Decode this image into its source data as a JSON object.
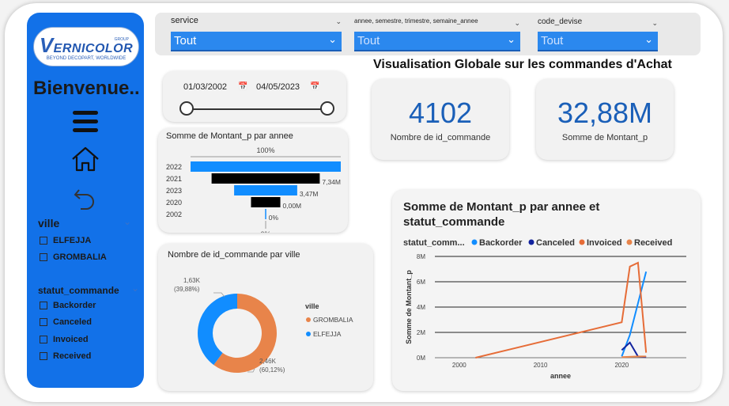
{
  "logo": {
    "brand": "ERNICOLOR",
    "brand_initial": "V",
    "tagline": "BEYOND DECOPART, WORLDWIDE",
    "group": "GROUP"
  },
  "sidebar": {
    "welcome": "Bienvenue..",
    "ville": {
      "title": "ville",
      "items": [
        "ELFEJJA",
        "GROMBALIA"
      ]
    },
    "statut": {
      "title": "statut_commande",
      "items": [
        "Backorder",
        "Canceled",
        "Invoiced",
        "Received"
      ]
    }
  },
  "filters": {
    "service": {
      "label": "service",
      "value": "Tout"
    },
    "periode": {
      "label": "annee, semestre, trimestre, semaine_annee",
      "value": "Tout"
    },
    "devise": {
      "label": "code_devise",
      "value": "Tout"
    }
  },
  "heading": "Visualisation Globale sur les commandes d'Achat",
  "date_range": {
    "start": "01/03/2002",
    "end": "04/05/2023"
  },
  "kpis": {
    "commandes": {
      "value": "4102",
      "label": "Nombre de id_commande"
    },
    "montant": {
      "value": "32,88M",
      "label": "Somme de Montant_p"
    }
  },
  "colors": {
    "accent": "#1271e8",
    "backorder": "#118dff",
    "canceled": "#12239e",
    "invoiced": "#e66c37",
    "received": "#e8844a"
  },
  "chart_data": [
    {
      "type": "bar",
      "title": "Somme de Montant_p par annee",
      "categories": [
        "2022",
        "2021",
        "2023",
        "2020",
        "2002"
      ],
      "values": [
        100,
        72,
        42,
        19.5,
        0
      ],
      "data_labels": [
        "100%",
        "",
        "7,34M",
        "3,47M",
        "0,00M",
        "0%"
      ],
      "top_label": "100%",
      "bottom_label": "0%",
      "bar_colors": [
        "#118dff",
        "#000000",
        "#118dff",
        "#000000",
        "#118dff"
      ]
    },
    {
      "type": "pie",
      "title": "Nombre de id_commande par ville",
      "legend_title": "ville",
      "slices": [
        {
          "name": "GROMBALIA",
          "value": 2.46,
          "label": "2,46K",
          "pct": "(60,12%)",
          "color": "#e8844a"
        },
        {
          "name": "ELFEJJA",
          "value": 1.63,
          "label": "1,63K",
          "pct": "(39,88%)",
          "color": "#118dff"
        }
      ]
    },
    {
      "type": "line",
      "title": "Somme de Montant_p par annee et statut_commande",
      "legend_title": "statut_comm...",
      "xlabel": "annee",
      "ylabel": "Somme de Montant_p",
      "xlim": [
        1997,
        2026
      ],
      "ylim": [
        0,
        8
      ],
      "x_ticks": [
        "2000",
        "2010",
        "2020"
      ],
      "y_ticks": [
        "0M",
        "2M",
        "4M",
        "6M",
        "8M"
      ],
      "series": [
        {
          "name": "Backorder",
          "color": "#118dff",
          "points": [
            [
              2020,
              0.1
            ],
            [
              2021,
              1.8
            ],
            [
              2023,
              6.8
            ]
          ]
        },
        {
          "name": "Canceled",
          "color": "#12239e",
          "points": [
            [
              2020,
              0.6
            ],
            [
              2021,
              1.2
            ],
            [
              2022,
              0.1
            ],
            [
              2023,
              0.05
            ]
          ]
        },
        {
          "name": "Invoiced",
          "color": "#e66c37",
          "points": [
            [
              2002,
              0
            ],
            [
              2020,
              2.8
            ],
            [
              2021,
              7.2
            ],
            [
              2022,
              7.5
            ],
            [
              2023,
              0.4
            ]
          ]
        },
        {
          "name": "Received",
          "color": "#e8844a",
          "points": [
            [
              2020,
              0.05
            ],
            [
              2022,
              0.1
            ],
            [
              2023,
              0.1
            ]
          ]
        }
      ]
    }
  ]
}
